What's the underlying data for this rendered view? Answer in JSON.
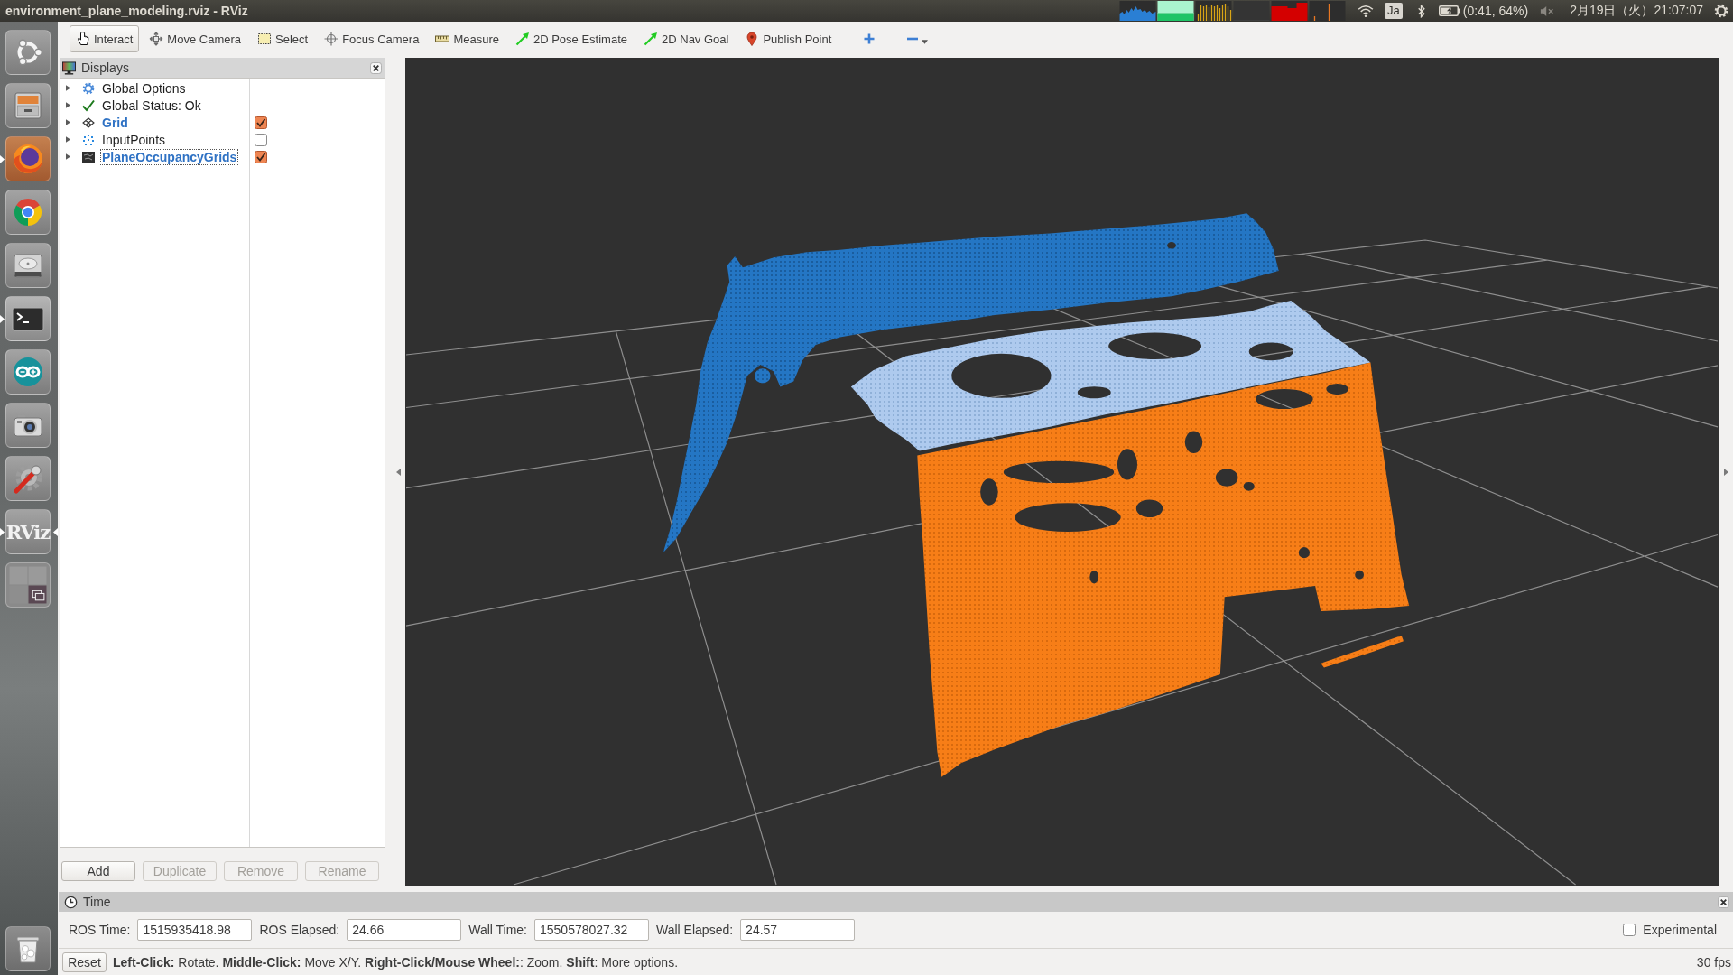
{
  "window": {
    "title": "environment_plane_modeling.rviz - RViz"
  },
  "top_panel": {
    "keyboard_layout": "Ja",
    "battery": "(0:41, 64%)",
    "volume_muted": true,
    "clock": "2月19日（火）21:07:07"
  },
  "launcher": {
    "items": [
      {
        "kind": "home",
        "running": false,
        "focused": false
      },
      {
        "kind": "files",
        "running": false,
        "focused": false
      },
      {
        "kind": "firefox",
        "running": true,
        "focused": false
      },
      {
        "kind": "chrome",
        "running": false,
        "focused": false
      },
      {
        "kind": "disk",
        "running": false,
        "focused": false
      },
      {
        "kind": "terminal",
        "running": true,
        "focused": false
      },
      {
        "kind": "arduino",
        "running": false,
        "focused": false
      },
      {
        "kind": "camera",
        "running": false,
        "focused": false
      },
      {
        "kind": "settings",
        "running": false,
        "focused": false
      },
      {
        "kind": "rviz",
        "label": "RViz",
        "running": true,
        "focused": true
      },
      {
        "kind": "workspaces",
        "running": false,
        "focused": false
      },
      {
        "kind": "trash",
        "running": false,
        "focused": false
      }
    ]
  },
  "toolbar": {
    "tools": [
      {
        "kind": "interact",
        "label": "Interact",
        "selected": true
      },
      {
        "kind": "move_camera",
        "label": "Move Camera",
        "selected": false
      },
      {
        "kind": "select",
        "label": "Select",
        "selected": false
      },
      {
        "kind": "focus_camera",
        "label": "Focus Camera",
        "selected": false
      },
      {
        "kind": "measure",
        "label": "Measure",
        "selected": false
      },
      {
        "kind": "pose_estimate",
        "label": "2D Pose Estimate",
        "selected": false
      },
      {
        "kind": "nav_goal",
        "label": "2D Nav Goal",
        "selected": false
      },
      {
        "kind": "publish_point",
        "label": "Publish Point",
        "selected": false
      }
    ],
    "extras": [
      {
        "kind": "add_tool"
      },
      {
        "kind": "remove_tool"
      }
    ]
  },
  "displays": {
    "title": "Displays",
    "items": [
      {
        "kind": "options",
        "label": "Global Options",
        "expanded": false,
        "selected": false
      },
      {
        "kind": "status",
        "label": "Global Status: Ok",
        "expanded": false,
        "selected": false
      },
      {
        "kind": "grid",
        "label": "Grid",
        "expanded": false,
        "selected": false,
        "checked": true
      },
      {
        "kind": "points",
        "label": "InputPoints",
        "expanded": false,
        "selected": false,
        "checked": false
      },
      {
        "kind": "map",
        "label": "PlaneOccupancyGrids",
        "expanded": false,
        "selected": true,
        "checked": true
      }
    ],
    "buttons": [
      {
        "label": "Add",
        "disabled": false
      },
      {
        "label": "Duplicate",
        "disabled": true
      },
      {
        "label": "Remove",
        "disabled": true
      },
      {
        "label": "Rename",
        "disabled": true
      }
    ]
  },
  "time": {
    "title": "Time",
    "fields": [
      {
        "label": "ROS Time:",
        "value": "1515935418.98"
      },
      {
        "label": "ROS Elapsed:",
        "value": "24.66"
      },
      {
        "label": "Wall Time:",
        "value": "1550578027.32"
      },
      {
        "label": "Wall Elapsed:",
        "value": "24.57"
      }
    ],
    "experimental": {
      "label": "Experimental",
      "checked": false
    }
  },
  "status_bar": {
    "reset": "Reset",
    "hint": "**Left-Click:** Rotate. **Middle-Click:** Move X/Y. **Right-Click/Mouse Wheel:**: Zoom. **Shift**: More options.",
    "fps": "30 fps"
  }
}
